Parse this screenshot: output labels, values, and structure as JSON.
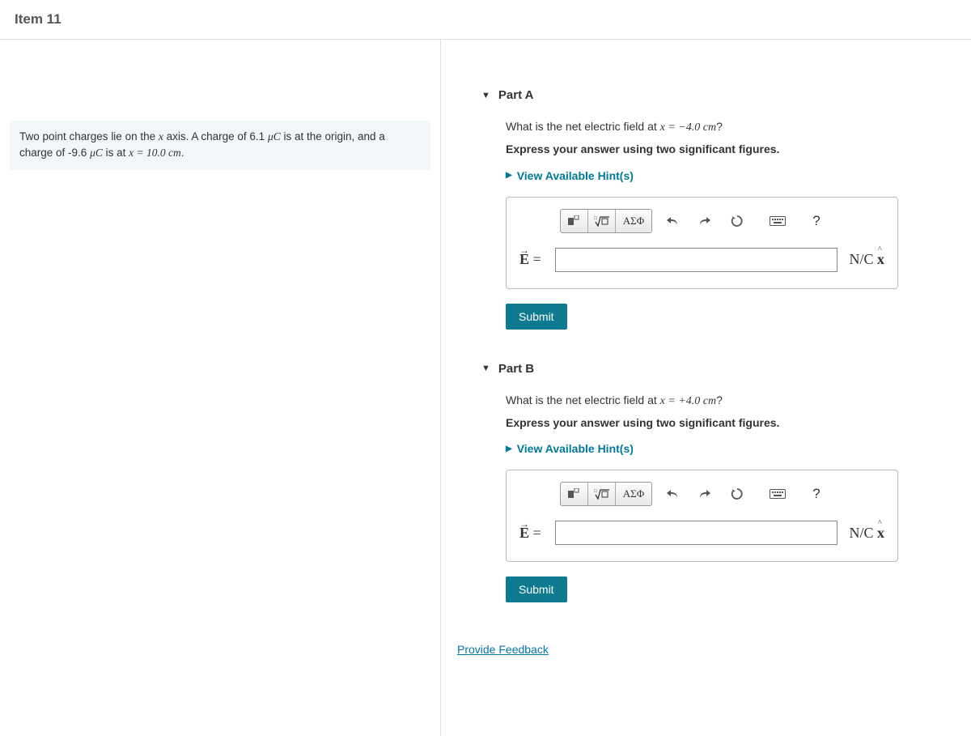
{
  "header": {
    "title": "Item 11"
  },
  "problem": {
    "text_before": "Two point charges lie on the ",
    "var_x": "x",
    "text_mid1": " axis. A charge of 6.1 ",
    "unit_uc": "μC",
    "text_mid2": " is at the origin, and a charge of -9.6 ",
    "text_mid3": " is at ",
    "eq": "x = 10.0 cm",
    "text_end": "."
  },
  "parts": {
    "a": {
      "label": "Part A",
      "question_pre": "What is the net electric field at ",
      "question_eq": "x = −4.0 cm",
      "question_post": "?",
      "instruction": "Express your answer using two significant figures.",
      "hints": "View Available Hint(s)",
      "var_label": "E⃗ =",
      "unit": "N/C x̂",
      "submit": "Submit",
      "toolbar": {
        "templates": "templates-icon",
        "root": "root-icon",
        "greek": "ΑΣΦ",
        "undo": "undo-icon",
        "redo": "redo-icon",
        "reset": "reset-icon",
        "keyboard": "keyboard-icon",
        "help": "?"
      }
    },
    "b": {
      "label": "Part B",
      "question_pre": "What is the net electric field at ",
      "question_eq": "x = +4.0 cm",
      "question_post": "?",
      "instruction": "Express your answer using two significant figures.",
      "hints": "View Available Hint(s)",
      "var_label": "E⃗ =",
      "unit": "N/C x̂",
      "submit": "Submit",
      "toolbar": {
        "templates": "templates-icon",
        "root": "root-icon",
        "greek": "ΑΣΦ",
        "undo": "undo-icon",
        "redo": "redo-icon",
        "reset": "reset-icon",
        "keyboard": "keyboard-icon",
        "help": "?"
      }
    }
  },
  "feedback": "Provide Feedback"
}
